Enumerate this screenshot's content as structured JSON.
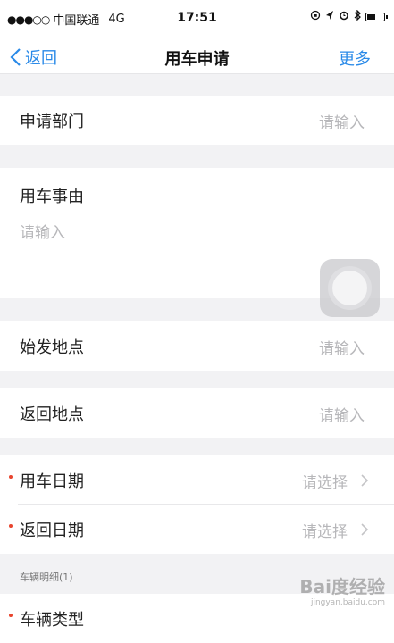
{
  "status_bar": {
    "signal": "●●●○○",
    "carrier": "中国联通",
    "network": "4G",
    "time": "17:51"
  },
  "nav": {
    "back_label": "返回",
    "title": "用车申请",
    "more_label": "更多"
  },
  "form": {
    "department": {
      "label": "申请部门",
      "placeholder": "请输入"
    },
    "reason": {
      "label": "用车事由",
      "placeholder": "请输入"
    },
    "start_location": {
      "label": "始发地点",
      "placeholder": "请输入"
    },
    "return_location": {
      "label": "返回地点",
      "placeholder": "请输入"
    },
    "use_date": {
      "label": "用车日期",
      "placeholder": "请选择"
    },
    "return_date": {
      "label": "返回日期",
      "placeholder": "请选择"
    },
    "vehicle_section": "车辆明细(1)",
    "vehicle_type": {
      "label": "车辆类型"
    }
  },
  "watermark": {
    "text": "Bai度经验",
    "sub": "jingyan.baidu.com"
  },
  "colors": {
    "accent": "#2a8ae8",
    "required": "#e8452e",
    "placeholder": "#b7b7ba"
  }
}
